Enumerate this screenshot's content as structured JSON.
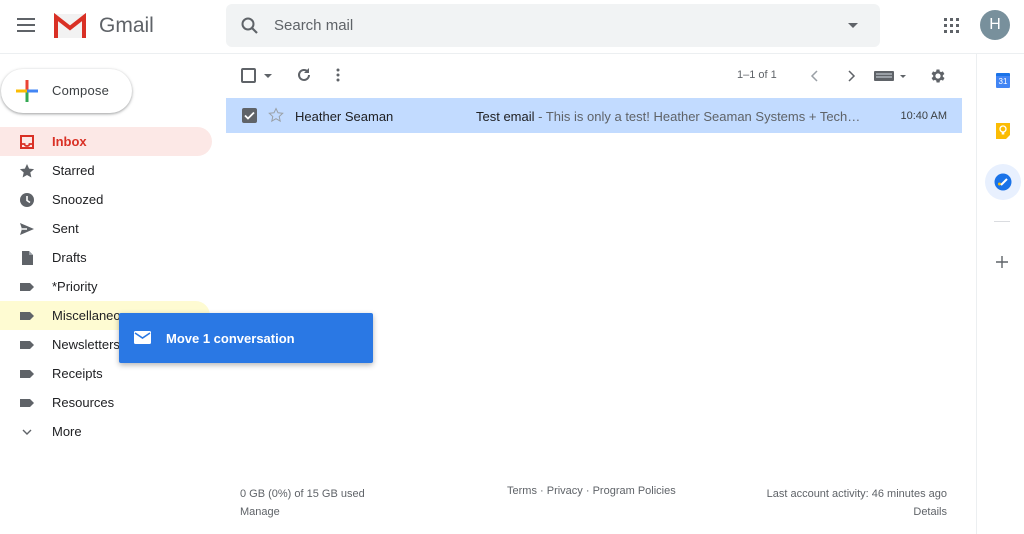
{
  "app": {
    "name": "Gmail"
  },
  "search": {
    "placeholder": "Search mail"
  },
  "account": {
    "initial": "H"
  },
  "compose": {
    "label": "Compose"
  },
  "nav": {
    "items": [
      {
        "label": "Inbox",
        "icon": "inbox-icon",
        "state": "active"
      },
      {
        "label": "Starred",
        "icon": "star-icon"
      },
      {
        "label": "Snoozed",
        "icon": "clock-icon"
      },
      {
        "label": "Sent",
        "icon": "send-icon"
      },
      {
        "label": "Drafts",
        "icon": "draft-icon"
      },
      {
        "label": "*Priority",
        "icon": "label-icon"
      },
      {
        "label": "Miscellaneous",
        "icon": "label-icon",
        "state": "drop-target"
      },
      {
        "label": "Newsletters",
        "icon": "label-icon"
      },
      {
        "label": "Receipts",
        "icon": "label-icon"
      },
      {
        "label": "Resources",
        "icon": "label-icon"
      },
      {
        "label": "More",
        "icon": "chevron-down-icon"
      }
    ]
  },
  "toolbar": {
    "pagination": "1–1 of 1"
  },
  "emails": [
    {
      "sender": "Heather Seaman",
      "subject": "Test email",
      "snippet": " - This is only a test! Heather Seaman Systems + Tech…",
      "time": "10:40 AM",
      "selected": true,
      "starred": false
    }
  ],
  "footer": {
    "storage": "0 GB (0%) of 15 GB used",
    "manage": "Manage",
    "terms": "Terms",
    "privacy": "Privacy",
    "policies": "Program Policies",
    "separator": " · ",
    "activity": "Last account activity: 46 minutes ago",
    "details": "Details"
  },
  "side_panel": {
    "calendar_day": "31"
  },
  "drag_tooltip": {
    "label": "Move 1 conversation"
  },
  "colors": {
    "accent_red": "#d93025",
    "selected_row": "#c2dbff",
    "drag_blue": "#2a78e4"
  }
}
